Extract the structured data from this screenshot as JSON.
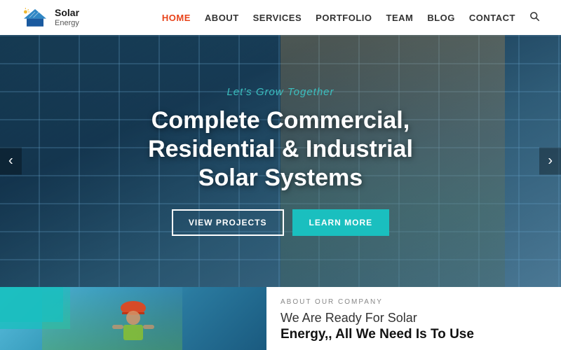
{
  "header": {
    "logo_solar": "Solar",
    "logo_energy": "Energy",
    "nav_items": [
      {
        "label": "HOME",
        "active": true
      },
      {
        "label": "ABOUT",
        "active": false
      },
      {
        "label": "SERVICES",
        "active": false
      },
      {
        "label": "PORTFOLIO",
        "active": false
      },
      {
        "label": "TEAM",
        "active": false
      },
      {
        "label": "BLOG",
        "active": false
      },
      {
        "label": "CONTACT",
        "active": false
      }
    ]
  },
  "hero": {
    "subtitle_plain": "Let's Grow ",
    "subtitle_accent": "Together",
    "title": "Complete Commercial, Residential & Industrial Solar Systems",
    "btn_view": "VIEW PROJECTS",
    "btn_learn": "LEARN MORE",
    "arrow_left": "‹",
    "arrow_right": "›"
  },
  "bottom": {
    "about_label": "ABOUT OUR COMPANY",
    "about_heading_normal": "We Are Ready For Solar",
    "about_heading_bold": "Energy,, All We Need Is To Use"
  }
}
